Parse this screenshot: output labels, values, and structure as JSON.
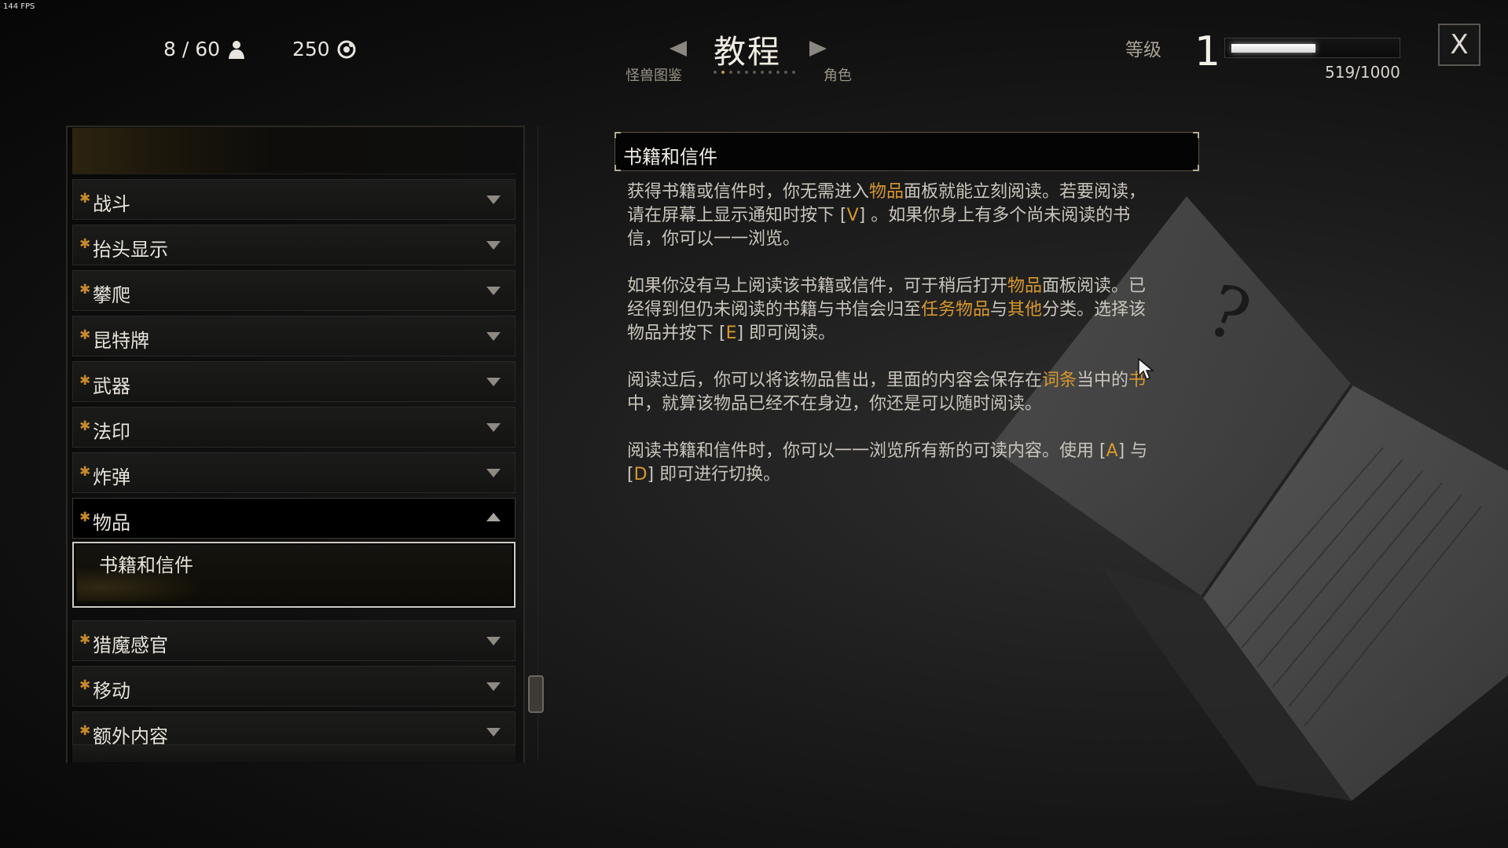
{
  "fps": "144 FPS",
  "top_stats": {
    "weight": "8 / 60",
    "money": "250"
  },
  "nav": {
    "title": "教程",
    "prev": "怪兽图鉴",
    "next": "角色",
    "page_count": 11,
    "active_page": 1
  },
  "level": {
    "label": "等级",
    "value": "1",
    "xp_text": "519/1000",
    "xp_fraction": 0.519
  },
  "close_label": "X",
  "categories": [
    {
      "label": "战斗"
    },
    {
      "label": "抬头显示"
    },
    {
      "label": "攀爬"
    },
    {
      "label": "昆特牌"
    },
    {
      "label": "武器"
    },
    {
      "label": "法印"
    },
    {
      "label": "炸弹"
    },
    {
      "label": "物品"
    },
    {
      "label": "猎魔感官"
    },
    {
      "label": "移动"
    },
    {
      "label": "额外内容"
    }
  ],
  "selected_entry": "书籍和信件",
  "article": {
    "title": "书籍和信件",
    "paragraphs": [
      [
        "获得书籍或信件时，你无需进入",
        "物品",
        "面板就能立刻阅读。若要阅读，请在屏幕上显示通知时按下 [",
        "V",
        "] 。如果你身上有多个尚未阅读的书信，你可以一一浏览。"
      ],
      [
        "如果你没有马上阅读该书籍或信件，可于稍后打开",
        "物品",
        "面板阅读。已经得到但仍未阅读的书籍与书信会归至",
        "任务物品",
        "与",
        "其他",
        "分类。选择该物品并按下 [",
        "E",
        "] 即可阅读。"
      ],
      [
        "阅读过后，你可以将该物品售出，里面的内容会保存在",
        "词条",
        "当中的",
        "书",
        "中，就算该物品已经不在身边，你还是可以随时阅读。"
      ],
      [
        "阅读书籍和信件时，你可以一一浏览所有新的可读内容。使用 [",
        "A",
        "] 与 [",
        "D",
        "] 即可进行切换。"
      ]
    ]
  },
  "colors": {
    "highlight": "#d8982c",
    "star": "#c88a2c",
    "background": "#0e0e0e"
  }
}
